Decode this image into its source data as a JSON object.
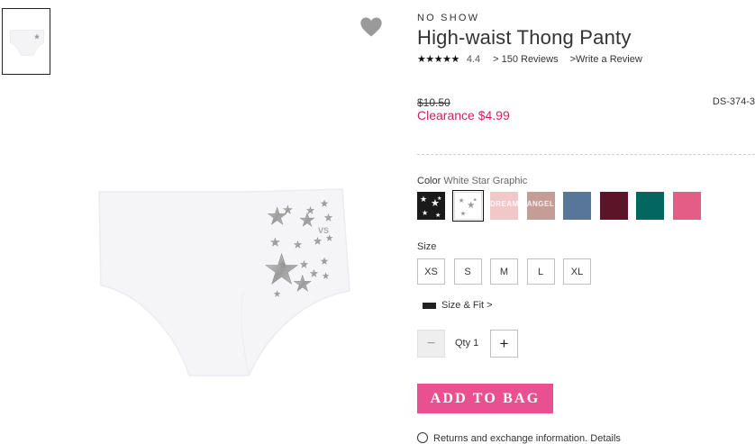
{
  "product": {
    "eyebrow": "NO SHOW",
    "title": "High-waist Thong Panty",
    "stars": "★★★★★",
    "rating": "4.4",
    "reviews_link": "> 150 Reviews",
    "write_review_link": ">Write a Review",
    "old_price": "$10.50",
    "clearance_price": "Clearance $4.99",
    "sku": "DS-374-3"
  },
  "color": {
    "label": "Color",
    "selected_value": "White Star Graphic",
    "swatches": [
      {
        "name": "black-star",
        "hex": "#1a1a1a",
        "text": ""
      },
      {
        "name": "white-star",
        "hex": "#ffffff",
        "text": ""
      },
      {
        "name": "blush-print",
        "hex": "#f2c7c8",
        "text": "DREAM"
      },
      {
        "name": "mauve-print",
        "hex": "#c59d96",
        "text": "ANGEL"
      },
      {
        "name": "slate-blue",
        "hex": "#577698",
        "text": ""
      },
      {
        "name": "burgundy",
        "hex": "#5c1428",
        "text": ""
      },
      {
        "name": "teal",
        "hex": "#04675f",
        "text": ""
      },
      {
        "name": "pink",
        "hex": "#e45d87",
        "text": ""
      }
    ]
  },
  "size": {
    "label": "Size",
    "options": [
      "XS",
      "S",
      "M",
      "L",
      "XL"
    ]
  },
  "size_fit": "Size & Fit >",
  "qty": {
    "minus": "−",
    "label": "Qty 1",
    "plus": "+"
  },
  "add_to_bag": "ADD TO BAG",
  "returns": "Returns and exchange information. Details",
  "colors": {
    "accent": "#e8508f",
    "clearance": "#d0245c"
  }
}
